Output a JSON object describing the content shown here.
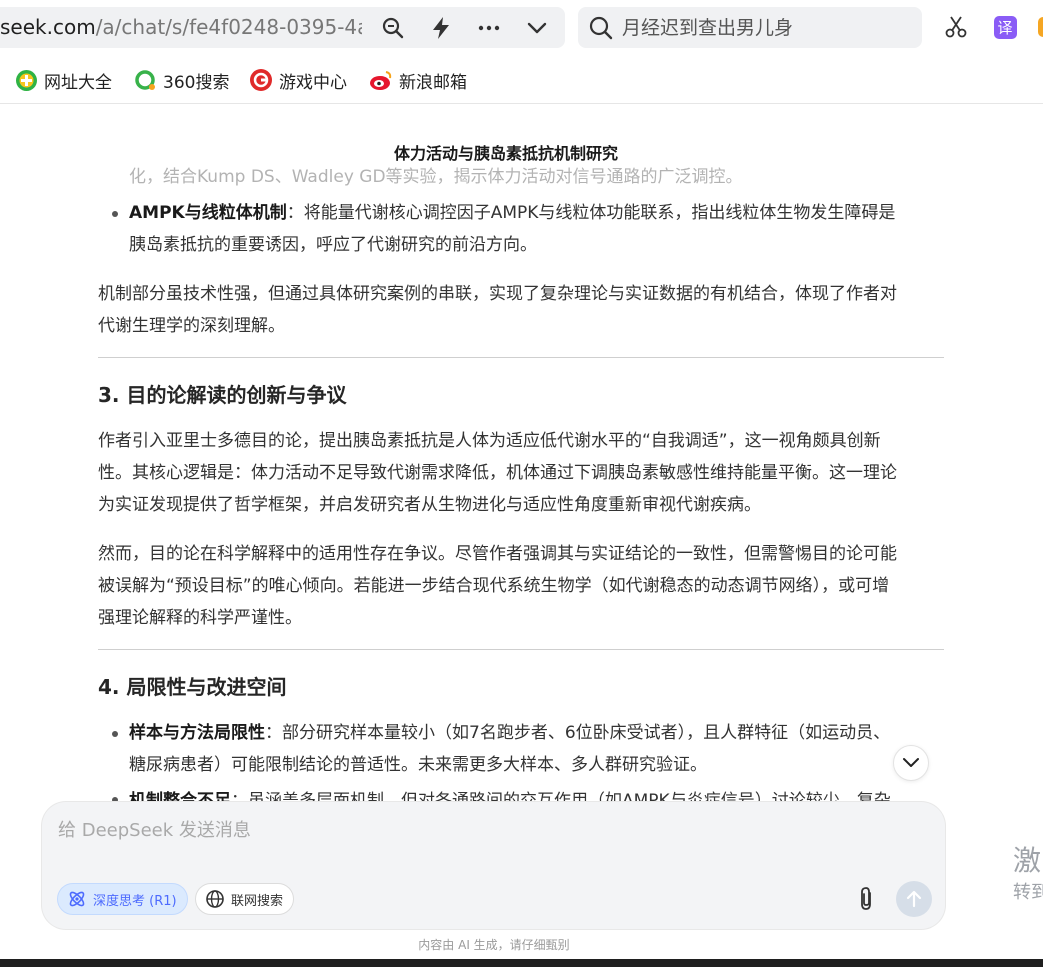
{
  "browser": {
    "address_host": "seek.com",
    "address_path": "/a/chat/s/fe4f0248-0395-4a",
    "search_placeholder": "月经迟到查出男儿身",
    "translate_label": "译",
    "bookmarks": [
      {
        "label": "网址大全",
        "icon": "plus-circle-icon"
      },
      {
        "label": "360搜索",
        "icon": "360-search-icon"
      },
      {
        "label": "游戏中心",
        "icon": "game-center-icon"
      },
      {
        "label": "新浪邮箱",
        "icon": "sina-mail-icon"
      }
    ]
  },
  "chat": {
    "title": "体力活动与胰岛素抵抗机制研究",
    "top_faded": "化，结合Kump DS、Wadley GD等实验，揭示体力活动对信号通路的广泛调控。",
    "ampk": {
      "term": "AMPK与线粒体机制",
      "line1": "：将能量代谢核心调控因子AMPK与线粒体功能联系，指出线粒体生物发生障碍是",
      "line2": "胰岛素抵抗的重要诱因，呼应了代谢研究的前沿方向。"
    },
    "para_mech": [
      "机制部分虽技术性强，但通过具体研究案例的串联，实现了复杂理论与实证数据的有机结合，体现了作者对",
      "代谢生理学的深刻理解。"
    ],
    "section3": {
      "heading": "3. 目的论解读的创新与争议",
      "para1": [
        "作者引入亚里士多德目的论，提出胰岛素抵抗是人体为适应低代谢水平的“自我调适”，这一视角颇具创新",
        "性。其核心逻辑是：体力活动不足导致代谢需求降低，机体通过下调胰岛素敏感性维持能量平衡。这一理论",
        "为实证发现提供了哲学框架，并启发研究者从生物进化与适应性角度重新审视代谢疾病。"
      ],
      "para2": [
        "然而，目的论在科学解释中的适用性存在争议。尽管作者强调其与实证结论的一致性，但需警惕目的论可能",
        "被误解为“预设目标”的唯心倾向。若能进一步结合现代系统生物学（如代谢稳态的动态调节网络），或可增",
        "强理论解释的科学严谨性。"
      ]
    },
    "section4": {
      "heading": "4. 局限性与改进空间",
      "item1_term": "样本与方法局限性",
      "item1_line1": "：部分研究样本量较小（如7名跑步者、6位卧床受试者），且人群特征（如运动员、",
      "item1_line2": "糖尿病患者）可能限制结论的普适性。未来需更多大样本、多人群研究验证。",
      "item2_term": "机制整合不足",
      "item2_line1": "：虽涵盖多层面机制，但对各通路间的交互作用（如AMPK与炎症信号）讨论较少，复杂"
    }
  },
  "composer": {
    "placeholder": "给 DeepSeek 发送消息",
    "deep_think_label": "深度思考 (R1)",
    "web_search_label": "联网搜索",
    "footer_note": "内容由 AI 生成，请仔细甄别"
  },
  "side_watermark": {
    "line1": "激",
    "line2": "转到"
  },
  "colors": {
    "accent": "#4d6bfe",
    "translate_bg": "#8a5cf6"
  }
}
